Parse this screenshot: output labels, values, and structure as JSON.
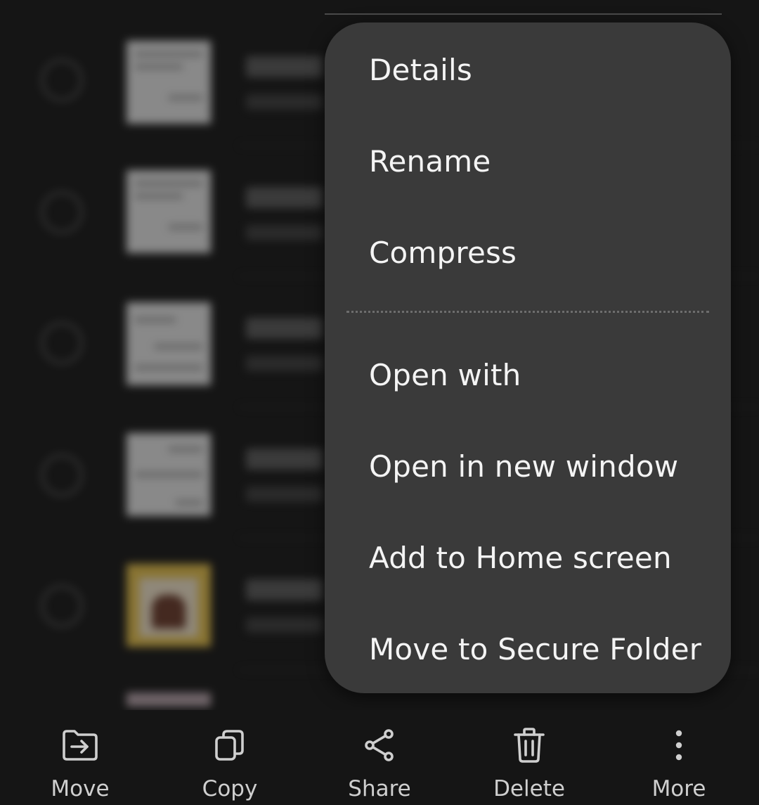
{
  "menu": {
    "items": [
      {
        "label": "Details"
      },
      {
        "label": "Rename"
      },
      {
        "label": "Compress"
      },
      {
        "label": "Open with"
      },
      {
        "label": "Open in new window"
      },
      {
        "label": "Add to Home screen"
      },
      {
        "label": "Move to Secure Folder"
      }
    ]
  },
  "toolbar": {
    "items": [
      {
        "label": "Move",
        "icon": "folder-move-icon"
      },
      {
        "label": "Copy",
        "icon": "copy-icon"
      },
      {
        "label": "Share",
        "icon": "share-icon"
      },
      {
        "label": "Delete",
        "icon": "trash-icon"
      },
      {
        "label": "More",
        "icon": "more-vertical-icon"
      }
    ]
  },
  "colors": {
    "background": "#151515",
    "popup": "#3a3a3a",
    "menu_text": "#f4f4f4",
    "toolbar_text": "#cfcfcf"
  }
}
